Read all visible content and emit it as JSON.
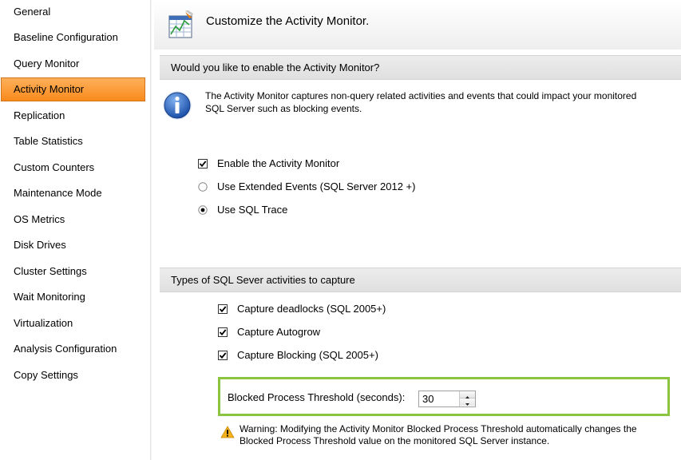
{
  "sidebar": {
    "items": [
      {
        "label": "General"
      },
      {
        "label": "Baseline Configuration"
      },
      {
        "label": "Query Monitor"
      },
      {
        "label": "Activity Monitor",
        "selected": true
      },
      {
        "label": "Replication"
      },
      {
        "label": "Table Statistics"
      },
      {
        "label": "Custom Counters"
      },
      {
        "label": "Maintenance Mode"
      },
      {
        "label": "OS Metrics"
      },
      {
        "label": "Disk Drives"
      },
      {
        "label": "Cluster Settings"
      },
      {
        "label": "Wait Monitoring"
      },
      {
        "label": "Virtualization"
      },
      {
        "label": "Analysis Configuration"
      },
      {
        "label": "Copy Settings"
      }
    ],
    "selected_color": "#f89a34"
  },
  "header": {
    "title": "Customize the Activity Monitor.",
    "icon": "activity-monitor-icon"
  },
  "section_enable": {
    "title": "Would you like to enable the Activity Monitor?",
    "info_icon": "info-icon",
    "info_text": "The Activity Monitor captures non-query related activities and events that could impact your monitored SQL Server such as blocking events.",
    "enable_label": "Enable the Activity Monitor",
    "enable_checked": true,
    "extended_events_label": "Use Extended Events (SQL Server 2012 +)",
    "extended_events_selected": false,
    "sql_trace_label": "Use SQL Trace",
    "sql_trace_selected": true
  },
  "section_capture": {
    "title": "Types of SQL Sever activities to capture",
    "deadlocks_label": "Capture deadlocks (SQL 2005+)",
    "deadlocks_checked": true,
    "autogrow_label": "Capture Autogrow",
    "autogrow_checked": true,
    "blocking_label": "Capture Blocking (SQL 2005+)",
    "blocking_checked": true,
    "threshold_label": "Blocked Process Threshold (seconds):",
    "threshold_value": "30",
    "highlight_color": "#8bc53f",
    "warning_icon": "warning-icon",
    "warning_text": "Warning: Modifying the Activity Monitor Blocked Process Threshold automatically changes the Blocked Process Threshold value on the monitored SQL Server instance."
  }
}
